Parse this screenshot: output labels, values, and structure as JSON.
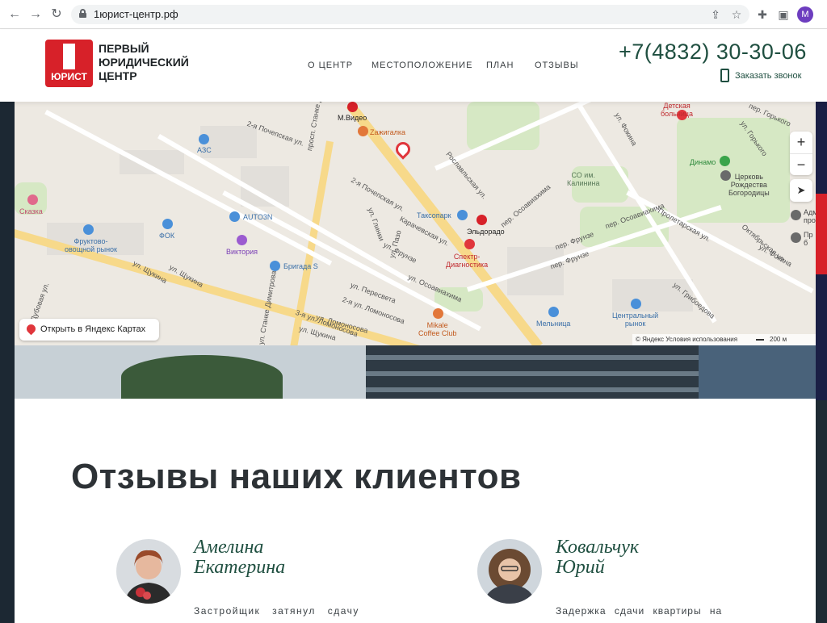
{
  "browser": {
    "url": "1юрист-центр.рф",
    "profile_initial": "M",
    "icons": [
      "back-icon",
      "forward-icon",
      "reload-icon",
      "lock-icon",
      "share-icon",
      "star-icon",
      "extensions-icon",
      "sidebar-icon"
    ]
  },
  "header": {
    "logo_word": "ЮРИСТ",
    "logo_line1": "ПЕРВЫЙ",
    "logo_line2": "ЮРИДИЧЕСКИЙ",
    "logo_line3": "ЦЕНТР",
    "nav": [
      "О ЦЕНТР",
      "МЕСТОПОЛОЖЕНИЕ",
      "ПЛАН",
      "ОТЗЫВЫ"
    ],
    "phone": "+7(4832) 30-30-06",
    "callback": "Заказать звонок",
    "accent": "#1f4f40",
    "brand_red": "#d72129"
  },
  "map": {
    "open_button": "Открыть в Яндекс Картах",
    "copyright": "© Яндекс  Условия использования",
    "scale": "200 м",
    "zoom_in": "+",
    "zoom_out": "−",
    "streets": [
      "2-я Почепская ул.",
      "проcп. Станке Димитрова",
      "2-я Почепская ул.",
      "ул. Глинки",
      "Карачевская ул.",
      "ул. Фрунзе",
      "ул. Пазо",
      "ул. Осоавиахима",
      "ул. Пересвета",
      "2-я ул. Ломоносова",
      "3-я ул. Ломоносова",
      "ул. Щукина",
      "ул. Щукина",
      "Дубовая ул.",
      "Рославльская ул.",
      "пер. Осоавиахима",
      "пер. Фрунзе",
      "пер. Фрунзе",
      "пер. Осоавиахима",
      "Пролетарская ул.",
      "ул. Фокина",
      "ул. Грибоедова",
      "Октябрьская ул.",
      "пер. Горького",
      "ул. Горького",
      "ул. Фокина",
      "ул. Щукина",
      "ул. Станке Димитрова",
      "ул. Ломоносова"
    ],
    "pois": [
      {
        "label": "М.Видео",
        "color": "#d72129"
      },
      {
        "label": "Zажигалка",
        "color": "#e2773a"
      },
      {
        "label": "АЗС",
        "color": "#4a90d9"
      },
      {
        "label": "Сказка",
        "color": "#e06a8c"
      },
      {
        "label": "AUTO3N",
        "color": "#4a90d9"
      },
      {
        "label": "ФОК",
        "color": "#4a90d9"
      },
      {
        "label": "Фруктово-\nовощной рынок",
        "color": "#4a90d9"
      },
      {
        "label": "Виктория",
        "color": "#9b5bd0"
      },
      {
        "label": "Бригада S",
        "color": "#4a90d9"
      },
      {
        "label": "Таксопарк",
        "color": "#4a90d9"
      },
      {
        "label": "Эльдорадо",
        "color": "#d72129"
      },
      {
        "label": "Спектр-\nДиагностика",
        "color": "#e0363c"
      },
      {
        "label": "Mikale\nCoffee Club",
        "color": "#e2773a"
      },
      {
        "label": "Мельница",
        "color": "#4a90d9"
      },
      {
        "label": "Центральный\nрынок",
        "color": "#4a90d9"
      },
      {
        "label": "СО им.\nКалинина",
        "color": "#6c8a6c"
      },
      {
        "label": "Динамо",
        "color": "#3aa44a"
      },
      {
        "label": "Церковь\nРождества\nБогородицы",
        "color": "#6a6a6a"
      },
      {
        "label": "Детская\nбольница",
        "color": "#e0363c"
      },
      {
        "label": "Адм\nпро",
        "color": "#6a6a6a"
      },
      {
        "label": "Пр\nб",
        "color": "#6a6a6a"
      }
    ]
  },
  "reviews": {
    "title": "Отзывы наших клиентов",
    "items": [
      {
        "name_line1": "Амелина",
        "name_line2": "Екатерина",
        "text": "Застройщик затянул сдачу"
      },
      {
        "name_line1": "Ковальчук",
        "name_line2": "Юрий",
        "text": "Задержка сдачи квартиры на"
      }
    ]
  }
}
